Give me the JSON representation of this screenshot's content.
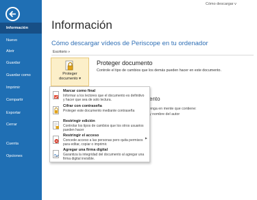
{
  "window": {
    "title": "Cómo descargar v"
  },
  "sidebar": {
    "items": [
      {
        "label": "Información"
      },
      {
        "label": "Nuevo"
      },
      {
        "label": "Abrir"
      },
      {
        "label": "Guardar"
      },
      {
        "label": "Guardar como"
      },
      {
        "label": "Imprimir"
      },
      {
        "label": "Compartir"
      },
      {
        "label": "Exportar"
      },
      {
        "label": "Cerrar"
      },
      {
        "label": "Cuenta"
      },
      {
        "label": "Opciones"
      }
    ]
  },
  "main": {
    "page_title": "Información",
    "doc_title": "Cómo descargar vídeos de Periscope en tu ordenador",
    "breadcrumb": "Escritorio »",
    "protect_button": "Proteger documento ▾",
    "section_title": "Proteger documento",
    "section_desc": "Controle el tipo de cambios que los demás pueden hacer en este documento.",
    "bg_heading_fragment": "ento",
    "bg_line1": "enga en mente que contiene:",
    "bg_line2": "y nombre del autor"
  },
  "menu": {
    "items": [
      {
        "title": "Marcar como final",
        "desc": "Informar a los lectores que el documento es definitivo y hacer que sea de solo lectura."
      },
      {
        "title": "Cifrar con contraseña",
        "desc": "Proteger este documento mediante contraseña"
      },
      {
        "title": "Restringir edición",
        "desc": "Controlar los tipos de cambios que los otros usuarios pueden hacer"
      },
      {
        "title": "Restringir el acceso",
        "desc": "Concede acceso a las personas pero quita permisos para editar, copiar o imprimir."
      },
      {
        "title": "Agregar una firma digital",
        "desc": "Garantiza la integridad del documento al agregar una firma digital invisible."
      }
    ]
  },
  "colors": {
    "sidebar": "#1f6fb4",
    "sidebar_active": "#174f86",
    "accent": "#2f6fb5"
  }
}
